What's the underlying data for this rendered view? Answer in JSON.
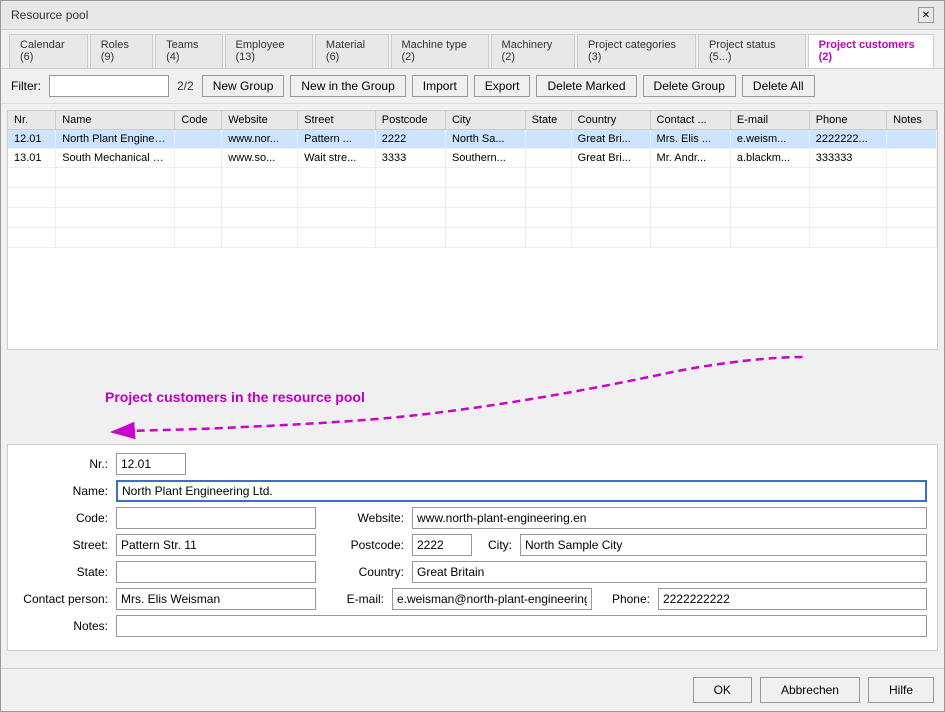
{
  "window": {
    "title": "Resource pool"
  },
  "tabs": [
    {
      "label": "Calendar (6)",
      "active": false
    },
    {
      "label": "Roles (9)",
      "active": false
    },
    {
      "label": "Teams (4)",
      "active": false
    },
    {
      "label": "Employee (13)",
      "active": false
    },
    {
      "label": "Material (6)",
      "active": false
    },
    {
      "label": "Machine type (2)",
      "active": false
    },
    {
      "label": "Machinery (2)",
      "active": false
    },
    {
      "label": "Project categories (3)",
      "active": false
    },
    {
      "label": "Project status (5...)",
      "active": false
    },
    {
      "label": "Project customers (2)",
      "active": true
    }
  ],
  "toolbar": {
    "filter_label": "Filter:",
    "filter_value": "",
    "filter_count": "2/2",
    "buttons": [
      "New Group",
      "New in the Group",
      "Import",
      "Export",
      "Delete Marked",
      "Delete Group",
      "Delete All"
    ]
  },
  "table": {
    "columns": [
      "Nr.",
      "Name",
      "Code",
      "Website",
      "Street",
      "Postcode",
      "City",
      "State",
      "Country",
      "Contact ...",
      "E-mail",
      "Phone",
      "Notes"
    ],
    "rows": [
      {
        "nr": "12.01",
        "name": "North Plant Engineering Ltd.",
        "code": "",
        "website": "www.nor...",
        "street": "Pattern ...",
        "postcode": "2222",
        "city": "North Sa...",
        "state": "",
        "country": "Great Bri...",
        "contact": "Mrs. Elis ...",
        "email": "e.weism...",
        "phone": "2222222...",
        "notes": "",
        "selected": true
      },
      {
        "nr": "13.01",
        "name": "South Mechanical Engineerin...",
        "code": "",
        "website": "www.so...",
        "street": "Wait stre...",
        "postcode": "3333",
        "city": "Southern...",
        "state": "",
        "country": "Great Bri...",
        "contact": "Mr. Andr...",
        "email": "a.blackm...",
        "phone": "333333",
        "notes": "",
        "selected": false
      }
    ]
  },
  "annotation": {
    "text": "Project customers in the resource pool"
  },
  "detail": {
    "nr_label": "Nr.:",
    "nr_value": "12.01",
    "name_label": "Name:",
    "name_value": "North Plant Engineering Ltd.",
    "code_label": "Code:",
    "code_value": "",
    "website_label": "Website:",
    "website_value": "www.north-plant-engineering.en",
    "street_label": "Street:",
    "street_value": "Pattern Str. 11",
    "postcode_label": "Postcode:",
    "postcode_value": "2222",
    "city_label": "City:",
    "city_value": "North Sample City",
    "state_label": "State:",
    "state_value": "",
    "country_label": "Country:",
    "country_value": "Great Britain",
    "contact_label": "Contact person:",
    "contact_value": "Mrs. Elis Weisman",
    "email_label": "E-mail:",
    "email_value": "e.weisman@north-plant-engineering.en",
    "phone_label": "Phone:",
    "phone_value": "2222222222",
    "notes_label": "Notes:",
    "notes_value": ""
  },
  "buttons": {
    "ok": "OK",
    "cancel": "Abbrechen",
    "help": "Hilfe"
  }
}
